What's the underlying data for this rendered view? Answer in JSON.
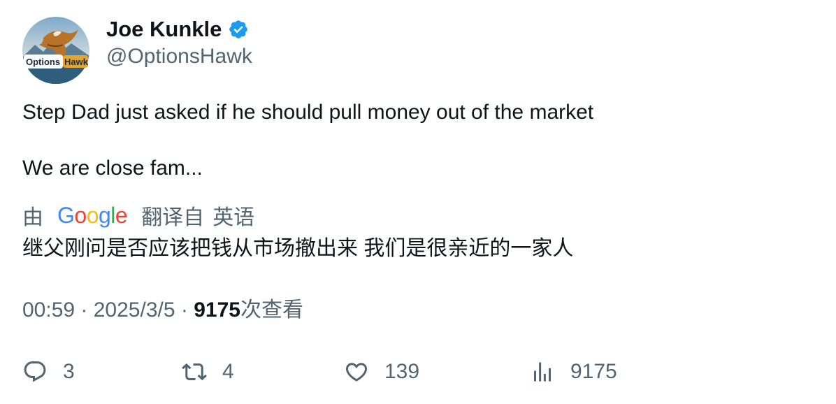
{
  "author": {
    "display_name": "Joe Kunkle",
    "handle": "@OptionsHawk",
    "verified": true,
    "avatar_text": "OptionsHawk"
  },
  "tweet": {
    "line1": "Step Dad just asked if he should pull money out of the market",
    "line2": "We are close fam..."
  },
  "translation_bar": {
    "prefix": "由",
    "provider": "Google",
    "suffix": "翻译自",
    "language": "英语"
  },
  "translation": {
    "text": "继父刚问是否应该把钱从市场撤出来 我们是很亲近的一家人"
  },
  "meta": {
    "time": "00:59",
    "separator": "·",
    "date": "2025/3/5",
    "views_count": "9175",
    "views_label": "次查看"
  },
  "actions": {
    "reply_count": "3",
    "retweet_count": "4",
    "like_count": "139",
    "views_count": "9175"
  },
  "colors": {
    "text_primary": "#0f1419",
    "text_secondary": "#536471",
    "verified_blue": "#1d9bf0"
  },
  "icons": [
    "verified-badge-icon",
    "reply-icon",
    "retweet-icon",
    "like-icon",
    "views-icon"
  ]
}
